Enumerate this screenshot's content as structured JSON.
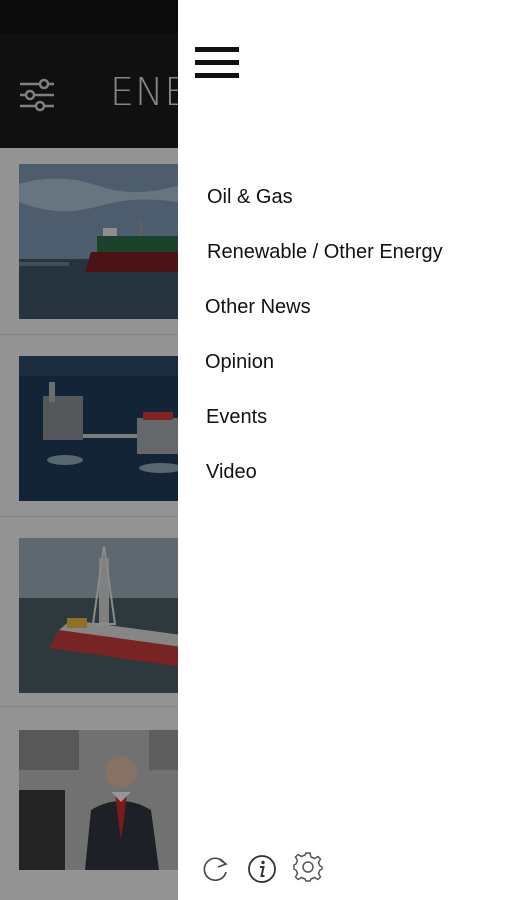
{
  "app": {
    "title": "ENERGY"
  },
  "feed": {
    "items": [
      {
        "image": "tanker-ship-photo"
      },
      {
        "image": "offshore-platform-photo"
      },
      {
        "image": "drillship-photo"
      },
      {
        "image": "executive-portrait-photo"
      }
    ]
  },
  "drawer": {
    "menu": [
      "Oil & Gas",
      "Renewable / Other Energy",
      "Other News",
      "Opinion",
      "Events",
      "Video"
    ],
    "footer_icons": [
      "refresh-icon",
      "info-icon",
      "settings-icon"
    ]
  }
}
